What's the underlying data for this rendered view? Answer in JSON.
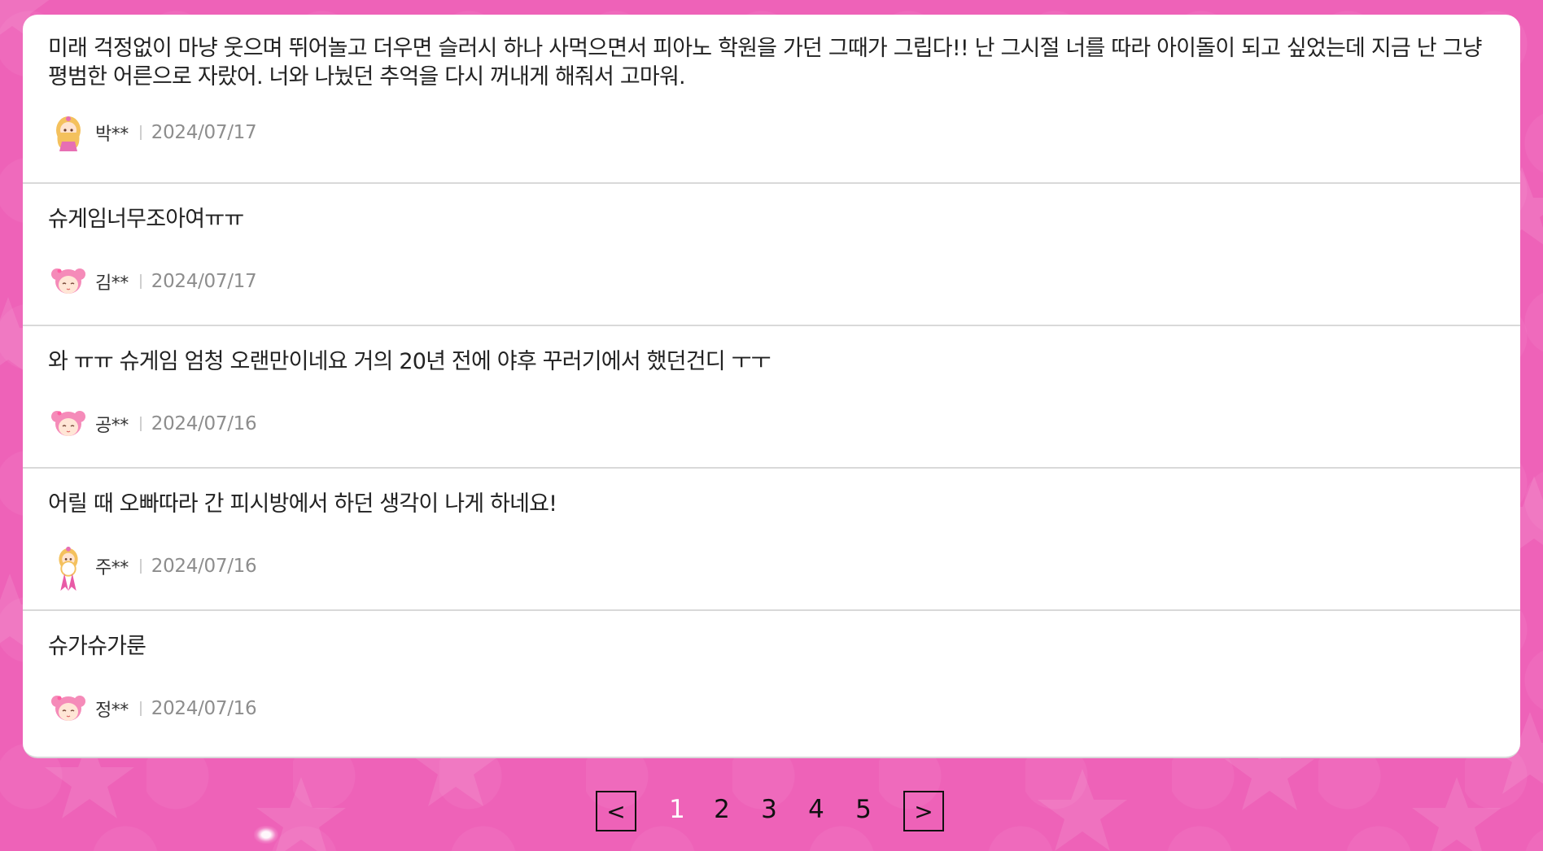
{
  "comments": [
    {
      "text": "미래 걱정없이 마냥 웃으며 뛰어놀고 더우면 슬러시 하나 사먹으면서 피아노 학원을 가던 그때가 그립다!! 난 그시절 너를 따라 아이돌이 되고 싶었는데 지금 난 그냥 평범한 어른으로 자랐어. 너와 나눴던 추억을 다시 꺼내게 해줘서 고마워.",
      "author": "박**",
      "date": "2024/07/17",
      "avatar": "blonde-girl-avatar-icon"
    },
    {
      "text": "슈게임너무조아여ㅠㅠ",
      "author": "김**",
      "date": "2024/07/17",
      "avatar": "pink-hair-girl-avatar-icon"
    },
    {
      "text": "와 ㅠㅠ 슈게임 엄청 오랜만이네요 거의 20년 전에 야후 꾸러기에서 했던건디 ㅜㅜ",
      "author": "공**",
      "date": "2024/07/16",
      "avatar": "pink-hair-girl-avatar-icon"
    },
    {
      "text": "어릴 때 오빠따라 간 피시방에서 하던 생각이 나게 하네요!",
      "author": "주**",
      "date": "2024/07/16",
      "avatar": "blonde-girl-ribbon-avatar-icon"
    },
    {
      "text": "슈가슈가룬",
      "author": "정**",
      "date": "2024/07/16",
      "avatar": "pink-hair-girl-avatar-icon"
    }
  ],
  "pagination": {
    "prev_label": "<",
    "next_label": ">",
    "pages": [
      "1",
      "2",
      "3",
      "4",
      "5"
    ],
    "current_page": "1"
  },
  "colors": {
    "background": "#ee62b8",
    "card": "#ffffff",
    "active_page": "#ffffff"
  }
}
